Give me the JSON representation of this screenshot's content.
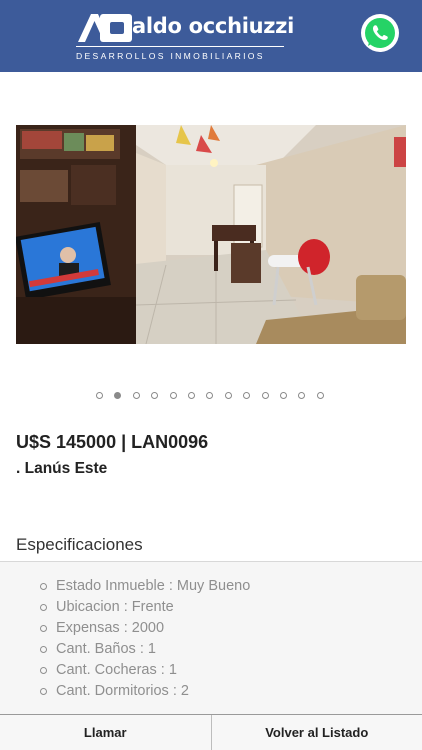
{
  "header": {
    "brand_name": "aldo occhiuzzi",
    "brand_tagline": "DESARROLLOS INMOBILIARIOS",
    "logo_icon": "ao-logo-icon",
    "whatsapp_icon": "whatsapp-icon",
    "colors": {
      "background": "#3d5b9a",
      "whatsapp": "#25d366"
    }
  },
  "gallery": {
    "image_icon": "apartment-living-room-photo",
    "total_slides": 13,
    "active_index": 1
  },
  "listing": {
    "price_code": "U$S 145000 | LAN0096",
    "location": ". Lanús Este"
  },
  "specs": {
    "title": "Especificaciones",
    "items": [
      {
        "label": "Estado Inmueble : Muy Bueno"
      },
      {
        "label": "Ubicacion : Frente"
      },
      {
        "label": "Expensas : 2000"
      },
      {
        "label": "Cant. Baños : 1"
      },
      {
        "label": "Cant. Cocheras : 1"
      },
      {
        "label": "Cant. Dormitorios : 2"
      }
    ]
  },
  "actions": {
    "call_label": "Llamar",
    "back_label": "Volver al Listado"
  }
}
